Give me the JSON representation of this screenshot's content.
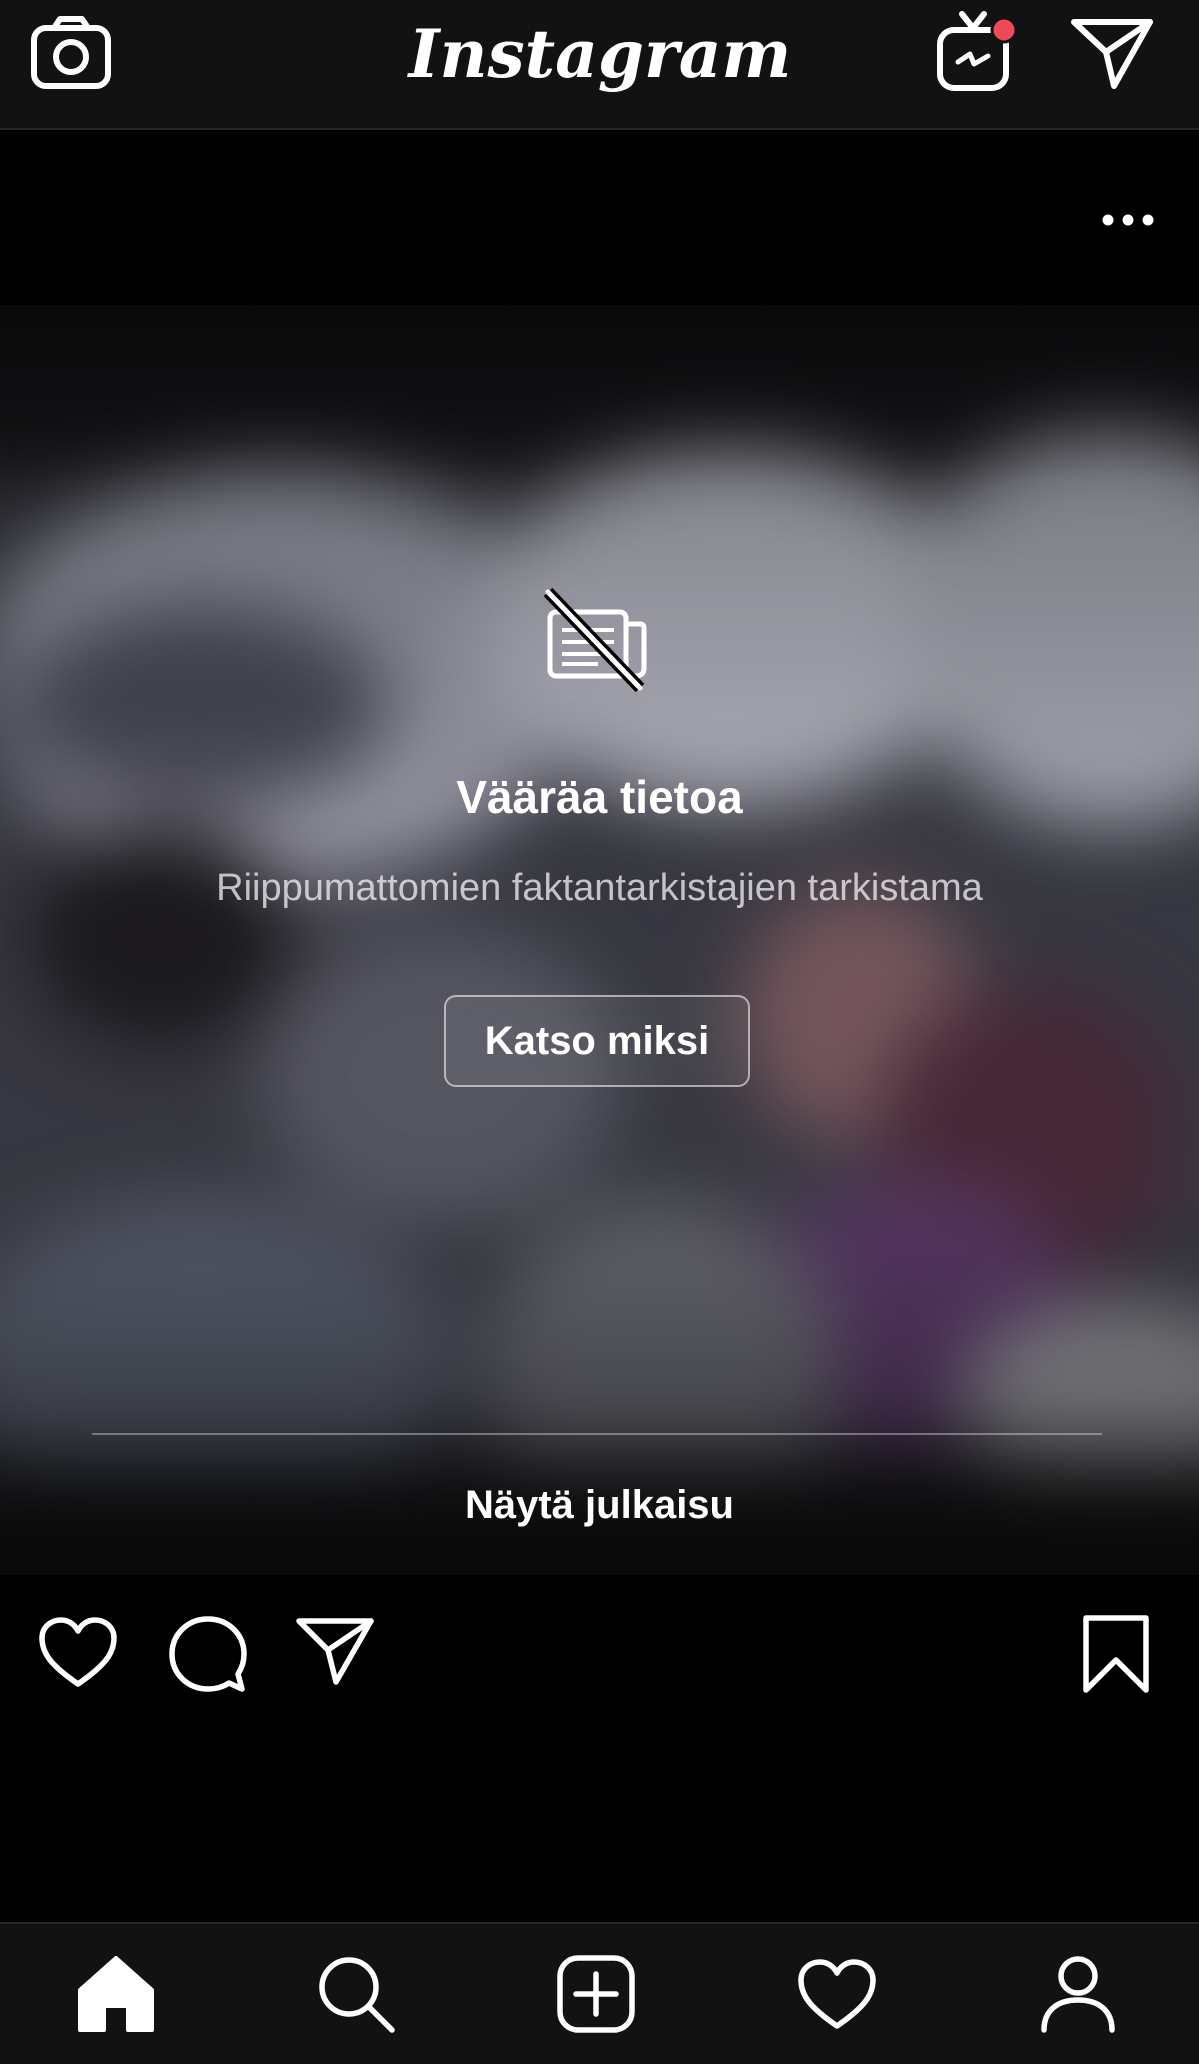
{
  "header": {
    "app_title": "Instagram",
    "icons": [
      "camera-icon",
      "igtv-icon",
      "direct-message-icon"
    ],
    "igtv_notification_color": "#ed4956"
  },
  "post": {
    "options_icon": "more-options-icon",
    "false_info": {
      "icon": "false-news-icon",
      "title": "Vääräa tietoa",
      "subtitle": "Riippumattomien faktantarkistajien tarkistama",
      "see_why_label": "Katso miksi",
      "show_post_label": "Näytä julkaisu"
    },
    "actions": [
      "like-icon",
      "comment-icon",
      "share-icon",
      "save-icon"
    ]
  },
  "bottom_nav": {
    "items": [
      "home-icon",
      "search-icon",
      "new-post-icon",
      "activity-icon",
      "profile-icon"
    ]
  },
  "colors": {
    "background": "#000000",
    "bar_background": "#121212",
    "text": "#ffffff"
  }
}
